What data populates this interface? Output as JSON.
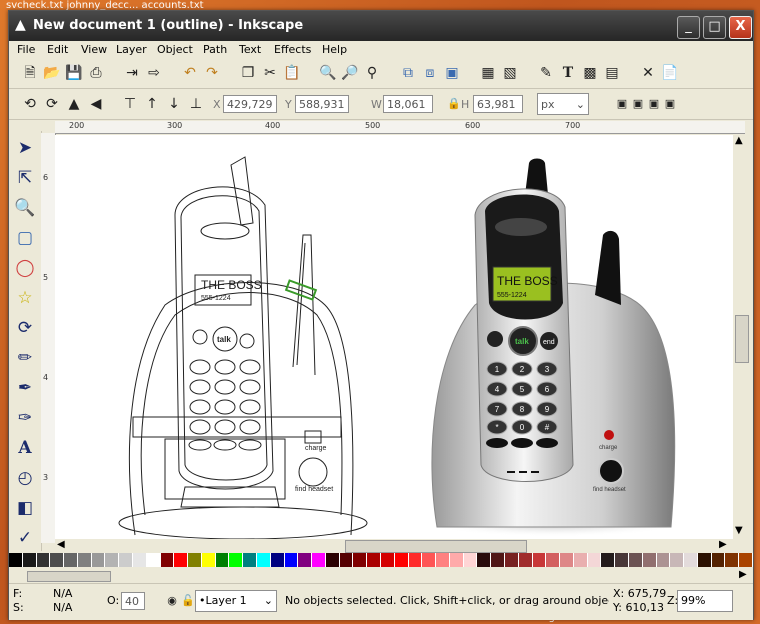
{
  "desktop": {
    "text_top": "svcheck.txt    johnny_decc...    accounts.txt",
    "text_bottom": "designer.rtf"
  },
  "window": {
    "title": "New document 1 (outline) - Inkscape",
    "buttons": [
      "_",
      "□",
      "X"
    ]
  },
  "menu": [
    "File",
    "Edit",
    "View",
    "Layer",
    "Object",
    "Path",
    "Text",
    "Effects",
    "Help"
  ],
  "controls": {
    "x_label": "X",
    "x_value": "429,729",
    "y_label": "Y",
    "y_value": "588,931",
    "w_label": "W",
    "w_value": "18,061",
    "h_label": "H",
    "h_value": "63,981",
    "unit": "px"
  },
  "ruler": {
    "h_ticks": [
      "200",
      "300",
      "400",
      "500",
      "600",
      "700"
    ],
    "v_ticks": [
      "6",
      "5",
      "4",
      "3"
    ]
  },
  "artwork": {
    "lcd_line1": "THE BOSS",
    "lcd_line2": "555-1224",
    "talk": "talk",
    "end": "end",
    "keys": [
      "1",
      "2",
      "3",
      "4",
      "5",
      "6",
      "7",
      "8",
      "9",
      "*",
      "0",
      "#"
    ],
    "charge": "charge",
    "find_headset": "find headset"
  },
  "palette": [
    "#000000",
    "#1a1a1a",
    "#333333",
    "#4d4d4d",
    "#666666",
    "#808080",
    "#999999",
    "#b3b3b3",
    "#cccccc",
    "#e6e6e6",
    "#ffffff",
    "#800000",
    "#ff0000",
    "#808000",
    "#ffff00",
    "#008000",
    "#00ff00",
    "#008080",
    "#00ffff",
    "#000080",
    "#0000ff",
    "#800080",
    "#ff00ff",
    "#2b0000",
    "#550000",
    "#800000",
    "#aa0000",
    "#d40000",
    "#ff0000",
    "#ff2a2a",
    "#ff5555",
    "#ff8080",
    "#ffaaaa",
    "#ffd5d5",
    "#280b0b",
    "#501616",
    "#782121",
    "#a02c2c",
    "#c83737",
    "#d35f5f",
    "#de8787",
    "#e9afaf",
    "#f4d7d7",
    "#241c1c",
    "#483737",
    "#6c5353",
    "#916f6f",
    "#ac9393",
    "#c8b7b7",
    "#e3dbdb",
    "#2b1100",
    "#552200",
    "#803300",
    "#aa4400"
  ],
  "status": {
    "fill_label": "F:",
    "fill_value": "N/A",
    "stroke_label": "S:",
    "stroke_value": "N/A",
    "opacity_label": "O:",
    "opacity_value": "40",
    "layer": "•Layer 1",
    "message": "No objects selected. Click, Shift+click, or drag around objects to select.",
    "cursor_x": "X: 675,79",
    "cursor_y": "Y: 610,13",
    "zoom_label": "Z:",
    "zoom_value": "99%"
  }
}
